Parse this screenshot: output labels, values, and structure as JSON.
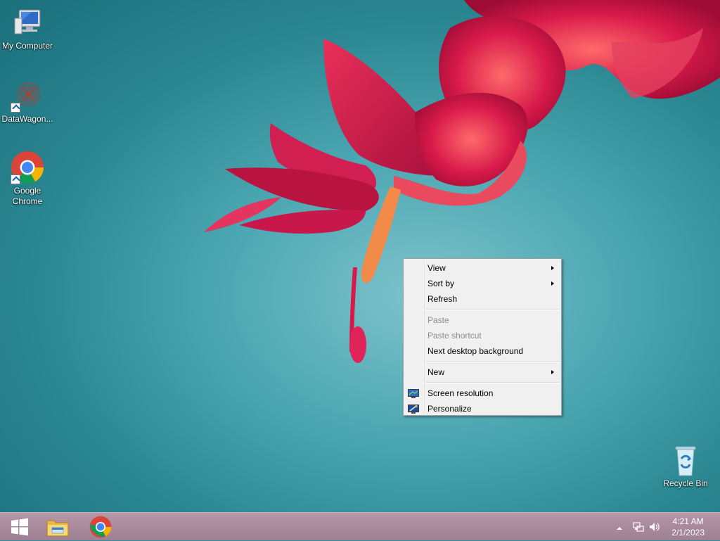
{
  "desktop": {
    "icons": [
      {
        "label": "My Computer",
        "icon": "computer-icon"
      },
      {
        "label": "DataWagon...",
        "icon": "datawagon-icon"
      },
      {
        "label": "Google",
        "label2": "Chrome",
        "icon": "chrome-icon"
      },
      {
        "label": "Recycle Bin",
        "icon": "recycle-bin-icon"
      }
    ]
  },
  "context_menu": {
    "items": {
      "view": "View",
      "sort_by": "Sort by",
      "refresh": "Refresh",
      "paste": "Paste",
      "paste_shortcut": "Paste shortcut",
      "next_background": "Next desktop background",
      "new": "New",
      "screen_resolution": "Screen resolution",
      "personalize": "Personalize"
    }
  },
  "taskbar": {
    "start": "windows-logo-icon",
    "pinned": [
      "file-explorer-icon",
      "chrome-icon"
    ],
    "tray": [
      "show-hidden-icons-chevron",
      "network-icon",
      "volume-icon"
    ],
    "time": "4:21 AM",
    "date": "2/1/2023"
  },
  "colors": {
    "taskbar": "#a88a9d",
    "wallpaper": "#4aa6b1",
    "flower": "#d81a4a"
  }
}
